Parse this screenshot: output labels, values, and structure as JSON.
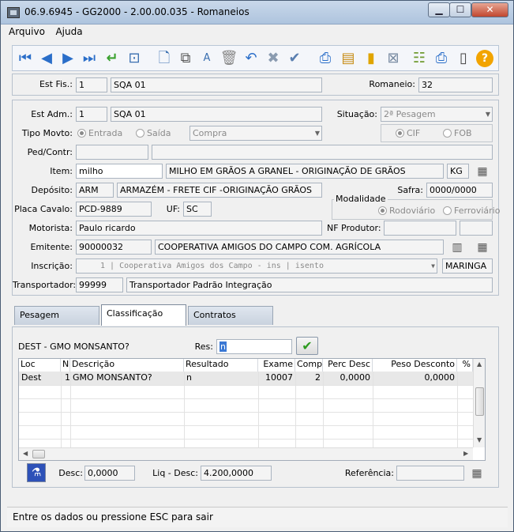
{
  "window": {
    "title": "06.9.6945 - GG2000 - 2.00.00.035 - Romaneios"
  },
  "menu": {
    "items": [
      "Arquivo",
      "Ajuda"
    ]
  },
  "toolbar": {
    "icons": [
      "first-record-icon",
      "prev-record-icon",
      "next-record-icon",
      "last-record-icon",
      "enter-icon",
      "preview-icon",
      "new-icon",
      "copy-icon",
      "edit-icon",
      "delete-icon",
      "undo-icon",
      "cancel-icon",
      "confirm-icon",
      "print-user-icon",
      "report-icon",
      "book-icon",
      "filter-icon",
      "tree-icon",
      "printer-icon",
      "exit-icon",
      "help-icon"
    ]
  },
  "header": {
    "est_fis_label": "Est Fis.:",
    "est_fis_code": "1",
    "est_fis_name": "SQA 01",
    "romaneio_label": "Romaneio:",
    "romaneio_value": "32"
  },
  "form": {
    "est_adm_label": "Est Adm.:",
    "est_adm_code": "1",
    "est_adm_name": "SQA 01",
    "situacao_label": "Situação:",
    "situacao_value": "2ª Pesagem",
    "tipo_movto_label": "Tipo Movto:",
    "entrada_label": "Entrada",
    "saida_label": "Saída",
    "compra_value": "Compra",
    "cif_label": "CIF",
    "fob_label": "FOB",
    "ped_contr_label": "Ped/Contr:",
    "item_label": "Item:",
    "item_code": "milho",
    "item_desc": "MILHO EM GRÃOS A GRANEL - ORIGINAÇÃO DE GRÃOS",
    "item_unit": "KG",
    "deposito_label": "Depósito:",
    "deposito_code": "ARM",
    "deposito_desc": "ARMAZÉM - FRETE CIF -ORIGINAÇÃO GRÃOS",
    "safra_label": "Safra:",
    "safra_value": "0000/0000",
    "modalidade_label": "Modalidade",
    "rodoviario_label": "Rodoviário",
    "ferroviario_label": "Ferroviário",
    "placa_label": "Placa Cavalo:",
    "placa_value": "PCD-9889",
    "uf_label": "UF:",
    "uf_value": "SC",
    "motorista_label": "Motorista:",
    "motorista_value": "Paulo ricardo",
    "nf_produtor_label": "NF Produtor:",
    "emitente_label": "Emitente:",
    "emitente_code": "90000032",
    "emitente_name": "COOPERATIVA AMIGOS DO CAMPO COM. AGRÍCOLA",
    "inscricao_label": "Inscrição:",
    "inscricao_value": "1 | Cooperativa Amigos dos Campo - ins | isento",
    "inscricao_city": "MARINGA",
    "transportador_label": "Transportador:",
    "transportador_code": "99999",
    "transportador_name": "Transportador Padrão Integração"
  },
  "tabs": [
    "Pesagem",
    "Classificação",
    "Contratos"
  ],
  "classificacao": {
    "question": "DEST - GMO MONSANTO?",
    "res_label": "Res:",
    "res_value": "n",
    "columns": [
      "Loc",
      "N",
      "Descrição",
      "Resultado",
      "Exame",
      "Comp",
      "Perc Desc",
      "Peso Desconto",
      "%"
    ],
    "rows": [
      {
        "loc": "Dest",
        "n": "1",
        "descricao": "GMO MONSANTO?",
        "resultado": "n",
        "exame": "10007",
        "comp": "2",
        "perc_desc": "0,0000",
        "peso_desconto": "0,0000"
      }
    ],
    "desc_label": "Desc:",
    "desc_value": "0,0000",
    "liq_desc_label": "Liq - Desc:",
    "liq_desc_value": "4.200,0000",
    "referencia_label": "Referência:"
  },
  "status": {
    "text": "Entre os dados ou pressione ESC para sair"
  }
}
